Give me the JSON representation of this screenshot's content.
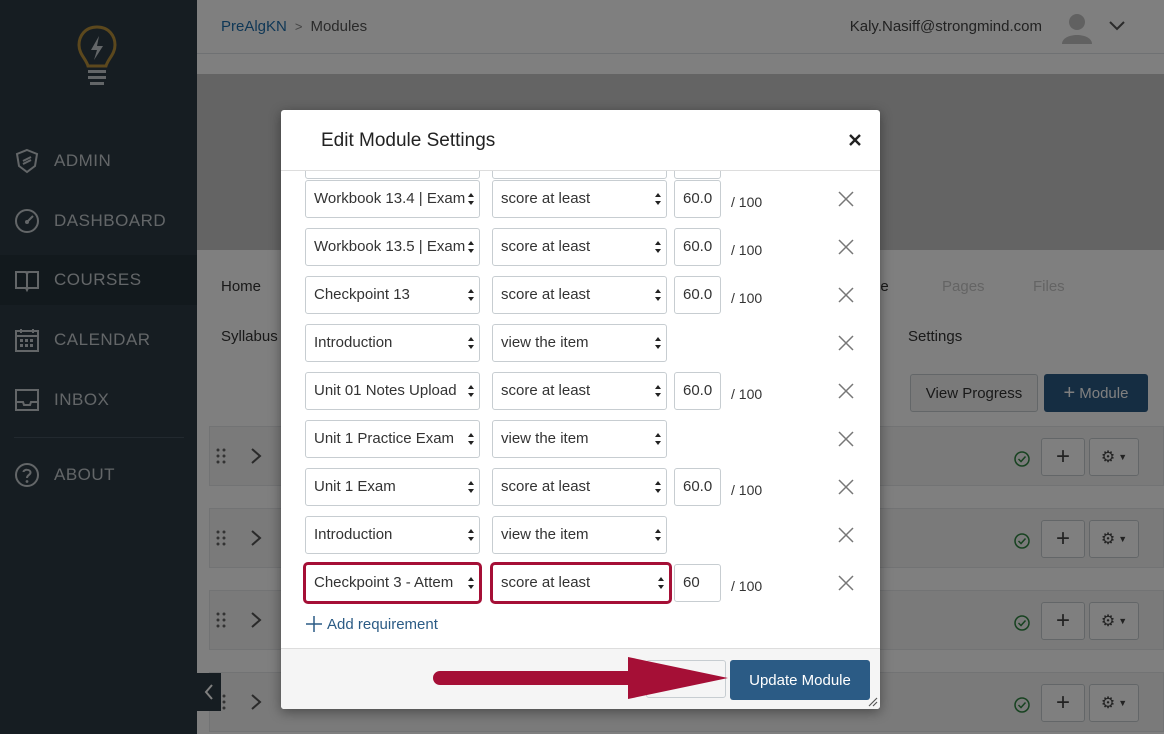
{
  "sidebar": {
    "logo_icon": "lightbulb-icon",
    "items": [
      {
        "label": "ADMIN",
        "icon": "shield-icon"
      },
      {
        "label": "DASHBOARD",
        "icon": "speedometer-icon"
      },
      {
        "label": "COURSES",
        "icon": "book-icon"
      },
      {
        "label": "CALENDAR",
        "icon": "calendar-icon"
      },
      {
        "label": "INBOX",
        "icon": "inbox-icon"
      },
      {
        "label": "ABOUT",
        "icon": "question-icon"
      }
    ],
    "active_item": "COURSES"
  },
  "header": {
    "breadcrumb_course": "PreAlgKN",
    "breadcrumb_separator": ">",
    "breadcrumb_page": "Modules",
    "user_email": "Kaly.Nasiff@strongmind.com"
  },
  "course_nav": {
    "home": "Home",
    "syllabus": "Syllabus",
    "partial_tab": "le",
    "pages": "Pages",
    "files": "Files",
    "settings": "Settings"
  },
  "toolbar": {
    "view_progress": "View Progress",
    "add_module": "Module"
  },
  "modal": {
    "title": "Edit Module Settings",
    "close_symbol": "×",
    "requirements": [
      {
        "item": "Workbook 13.4 | Exam",
        "condition": "score at least",
        "score": "60.0",
        "max": "/ 100"
      },
      {
        "item": "Workbook 13.5 | Exam",
        "condition": "score at least",
        "score": "60.0",
        "max": "/ 100"
      },
      {
        "item": "Checkpoint 13",
        "condition": "score at least",
        "score": "60.0",
        "max": "/ 100"
      },
      {
        "item": "Introduction",
        "condition": "view the item"
      },
      {
        "item": "Unit 01 Notes Upload",
        "condition": "score at least",
        "score": "60.0",
        "max": "/ 100"
      },
      {
        "item": "Unit 1 Practice Exam",
        "condition": "view the item"
      },
      {
        "item": "Unit 1 Exam",
        "condition": "score at least",
        "score": "60.0",
        "max": "/ 100"
      },
      {
        "item": "Introduction",
        "condition": "view the item"
      },
      {
        "item": "Checkpoint 3 - Attem",
        "condition": "score at least",
        "score": "60",
        "max": "/ 100",
        "highlighted": true
      }
    ],
    "add_requirement": "Add requirement",
    "update_button": "Update Module"
  },
  "colors": {
    "sidebar_bg": "#2d3b45",
    "primary_button": "#2b5b85",
    "highlight": "#a50f36"
  }
}
